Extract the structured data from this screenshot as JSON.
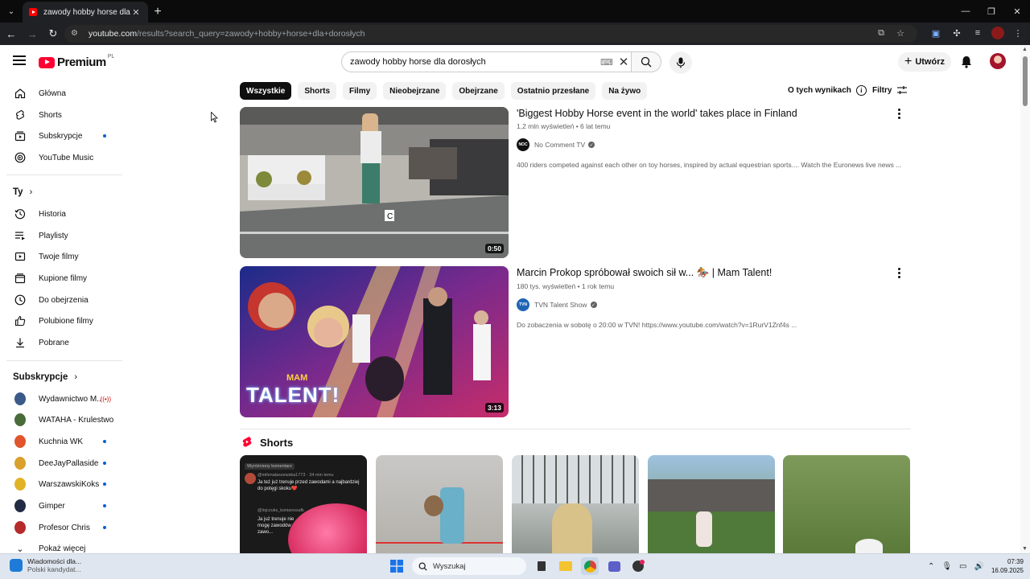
{
  "browser": {
    "tab_title": "zawody hobby horse dla dorosłych",
    "url_host": "youtube.com",
    "url_path": "/results?search_query=zawody+hobby+horse+dla+dorosłych"
  },
  "header": {
    "logo_text": "Premium",
    "logo_country": "PL",
    "search_query": "zawody hobby horse dla dorosłych",
    "create_label": "Utwórz"
  },
  "sidebar": {
    "main_items": [
      {
        "label": "Główna",
        "icon": "home-icon"
      },
      {
        "label": "Shorts",
        "icon": "shorts-icon"
      },
      {
        "label": "Subskrypcje",
        "icon": "subscriptions-icon"
      },
      {
        "label": "YouTube Music",
        "icon": "music-icon"
      }
    ],
    "you_heading": "Ty",
    "you_items": [
      {
        "label": "Historia",
        "icon": "history-icon"
      },
      {
        "label": "Playlisty",
        "icon": "playlist-icon"
      },
      {
        "label": "Twoje filmy",
        "icon": "your-videos-icon"
      },
      {
        "label": "Kupione filmy",
        "icon": "purchases-icon"
      },
      {
        "label": "Do obejrzenia",
        "icon": "watch-later-icon"
      },
      {
        "label": "Polubione filmy",
        "icon": "like-icon"
      },
      {
        "label": "Pobrane",
        "icon": "download-icon"
      }
    ],
    "subs_heading": "Subskrypcje",
    "subscriptions": [
      {
        "label": "Wydawnictwo M...",
        "color": "#3b5a8a",
        "status": "live"
      },
      {
        "label": "WATAHA - Krulestwo",
        "color": "#4a6b3a",
        "status": ""
      },
      {
        "label": "Kuchnia WK",
        "color": "#e0552b",
        "status": "new"
      },
      {
        "label": "DeeJayPallaside",
        "color": "#d9a02b",
        "status": "new"
      },
      {
        "label": "WarszawskiKoks",
        "color": "#e2b325",
        "status": "new"
      },
      {
        "label": "Gimper",
        "color": "#222a44",
        "status": "new"
      },
      {
        "label": "Profesor Chris",
        "color": "#b52b2b",
        "status": "new"
      }
    ],
    "show_more": "Pokaż więcej"
  },
  "filters": {
    "chips": [
      "Wszystkie",
      "Shorts",
      "Filmy",
      "Nieobejrzane",
      "Obejrzane",
      "Ostatnio przesłane",
      "Na żywo"
    ],
    "about_label": "O tych wynikach",
    "filters_label": "Filtry"
  },
  "videos": [
    {
      "title": "'Biggest Hobby Horse event in the world' takes place in Finland",
      "views": "1,2 mln wyświetleń",
      "age": "6 lat temu",
      "channel": "No Comment TV",
      "channel_badge": "NOC",
      "description": "400 riders competed against each other on toy horses, inspired by actual equestrian sports.... Watch the Euronews live news ...",
      "duration": "0:50"
    },
    {
      "title": "Marcin Prokop spróbował swoich sił w... 🏇 | Mam Talent!",
      "views": "180 tys. wyświetleń",
      "age": "1 rok temu",
      "channel": "TVN Talent Show",
      "channel_badge": "TVN",
      "description": "Do zobaczenia w sobotę o 20:00 w TVN! https://www.youtube.com/watch?v=1RurV1Znf4s ...",
      "duration": "3:13",
      "thumb_logo_top": "MAM",
      "thumb_logo_bottom": "TALENT!"
    }
  ],
  "shorts": {
    "heading": "Shorts",
    "first_comment_header": "Wyróżniony komentarz",
    "first_comment_user": "@milenalaszewska1773 · 34 min temu",
    "first_comment_text": "Ja też już trenuje przed zawodami a najbardziej do potęgi skoku❤️",
    "second_comment_user": "@lojczuks_koniarosudk",
    "second_comment_text": "Ja już trenuje nie mogę zawodów pani zawo..."
  },
  "taskbar": {
    "news_title": "Wiadomości dla...",
    "news_sub": "Polski kandydat...",
    "search_label": "Wyszukaj",
    "time": "07:39",
    "date": "16.09.2025"
  }
}
